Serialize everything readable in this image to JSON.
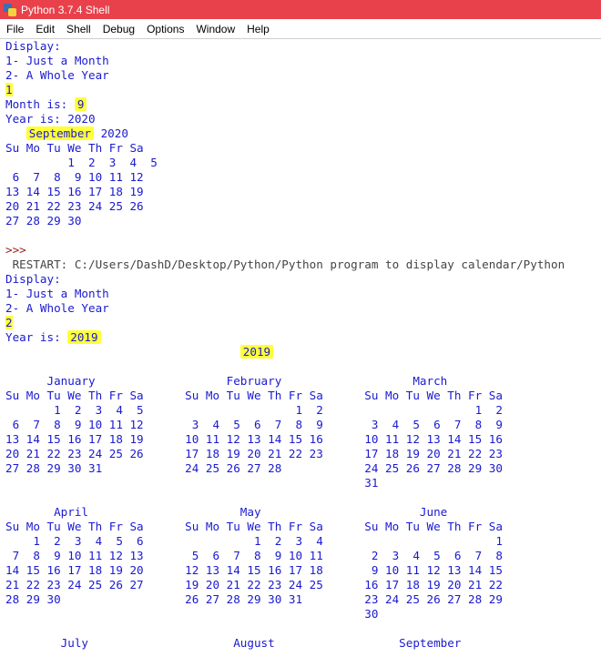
{
  "window": {
    "title": "Python 3.7.4 Shell"
  },
  "menu": [
    "File",
    "Edit",
    "Shell",
    "Debug",
    "Options",
    "Window",
    "Help"
  ],
  "session1": {
    "display_label": "Display:",
    "option1": "1- Just a Month",
    "option2": "2- A Whole Year",
    "choice": "1",
    "month_label": "Month is: ",
    "month_value": "9",
    "year_label": "Year is: 2020",
    "cal_month_name": "September",
    "cal_month_year": " 2020",
    "cal_header": "Su Mo Tu We Th Fr Sa",
    "cal_rows": [
      "         1  2  3  4  5",
      " 6  7  8  9 10 11 12",
      "13 14 15 16 17 18 19",
      "20 21 22 23 24 25 26",
      "27 28 29 30"
    ]
  },
  "prompt": ">>>",
  "restart_line": " RESTART: C:/Users/DashD/Desktop/Python/Python program to display calendar/Python",
  "session2": {
    "display_label": "Display:",
    "option1": "1- Just a Month",
    "option2": "2- A Whole Year",
    "choice": "2",
    "year_label": "Year is: ",
    "year_value": "2019",
    "year_title": "2019",
    "months": [
      {
        "name": "January",
        "rows": [
          "Su Mo Tu We Th Fr Sa",
          "       1  2  3  4  5",
          " 6  7  8  9 10 11 12",
          "13 14 15 16 17 18 19",
          "20 21 22 23 24 25 26",
          "27 28 29 30 31"
        ]
      },
      {
        "name": "February",
        "rows": [
          "Su Mo Tu We Th Fr Sa",
          "                1  2",
          " 3  4  5  6  7  8  9",
          "10 11 12 13 14 15 16",
          "17 18 19 20 21 22 23",
          "24 25 26 27 28"
        ]
      },
      {
        "name": "March",
        "rows": [
          "Su Mo Tu We Th Fr Sa",
          "                1  2",
          " 3  4  5  6  7  8  9",
          "10 11 12 13 14 15 16",
          "17 18 19 20 21 22 23",
          "24 25 26 27 28 29 30",
          "31"
        ]
      },
      {
        "name": "April",
        "rows": [
          "Su Mo Tu We Th Fr Sa",
          "    1  2  3  4  5  6",
          " 7  8  9 10 11 12 13",
          "14 15 16 17 18 19 20",
          "21 22 23 24 25 26 27",
          "28 29 30"
        ]
      },
      {
        "name": "May",
        "rows": [
          "Su Mo Tu We Th Fr Sa",
          "          1  2  3  4",
          " 5  6  7  8  9 10 11",
          "12 13 14 15 16 17 18",
          "19 20 21 22 23 24 25",
          "26 27 28 29 30 31"
        ]
      },
      {
        "name": "June",
        "rows": [
          "Su Mo Tu We Th Fr Sa",
          "                   1",
          " 2  3  4  5  6  7  8",
          " 9 10 11 12 13 14 15",
          "16 17 18 19 20 21 22",
          "23 24 25 26 27 28 29",
          "30"
        ]
      }
    ],
    "next_month_names": [
      "July",
      "August",
      "September"
    ]
  }
}
